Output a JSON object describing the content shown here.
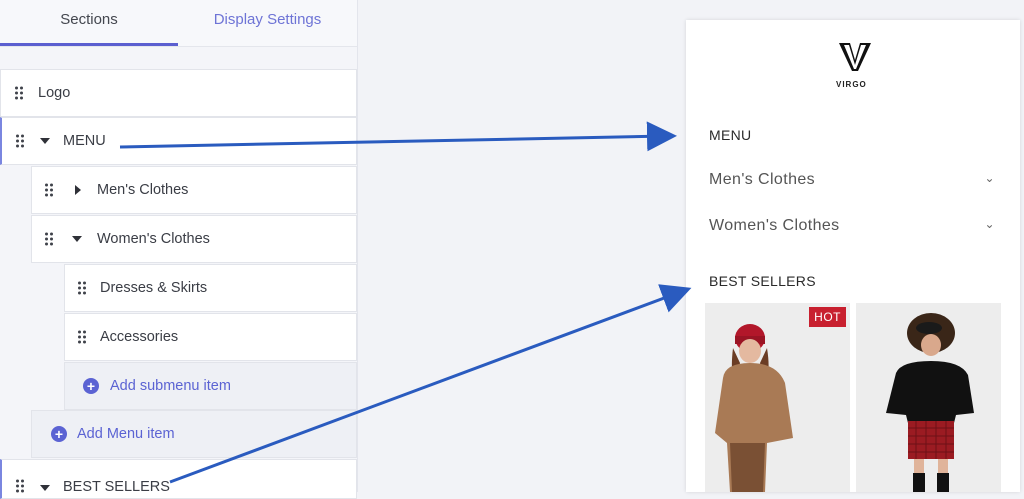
{
  "tabs": {
    "sections": "Sections",
    "display": "Display Settings"
  },
  "tree": {
    "logo": "Logo",
    "menu": "MENU",
    "mens": "Men's Clothes",
    "womens": "Women's Clothes",
    "dresses": "Dresses & Skirts",
    "accessories": "Accessories",
    "add_submenu": "Add submenu item",
    "add_menu": "Add Menu item",
    "best_sellers": "BEST SELLERS"
  },
  "preview": {
    "brand": "VIRGO",
    "menu_heading": "MENU",
    "menu_items": [
      "Men's Clothes",
      "Women's Clothes"
    ],
    "best_sellers_heading": "BEST SELLERS",
    "badge": "HOT"
  },
  "colors": {
    "accent": "#5b63d3",
    "arrow": "#2a5bbf",
    "badge": "#c8202f"
  }
}
